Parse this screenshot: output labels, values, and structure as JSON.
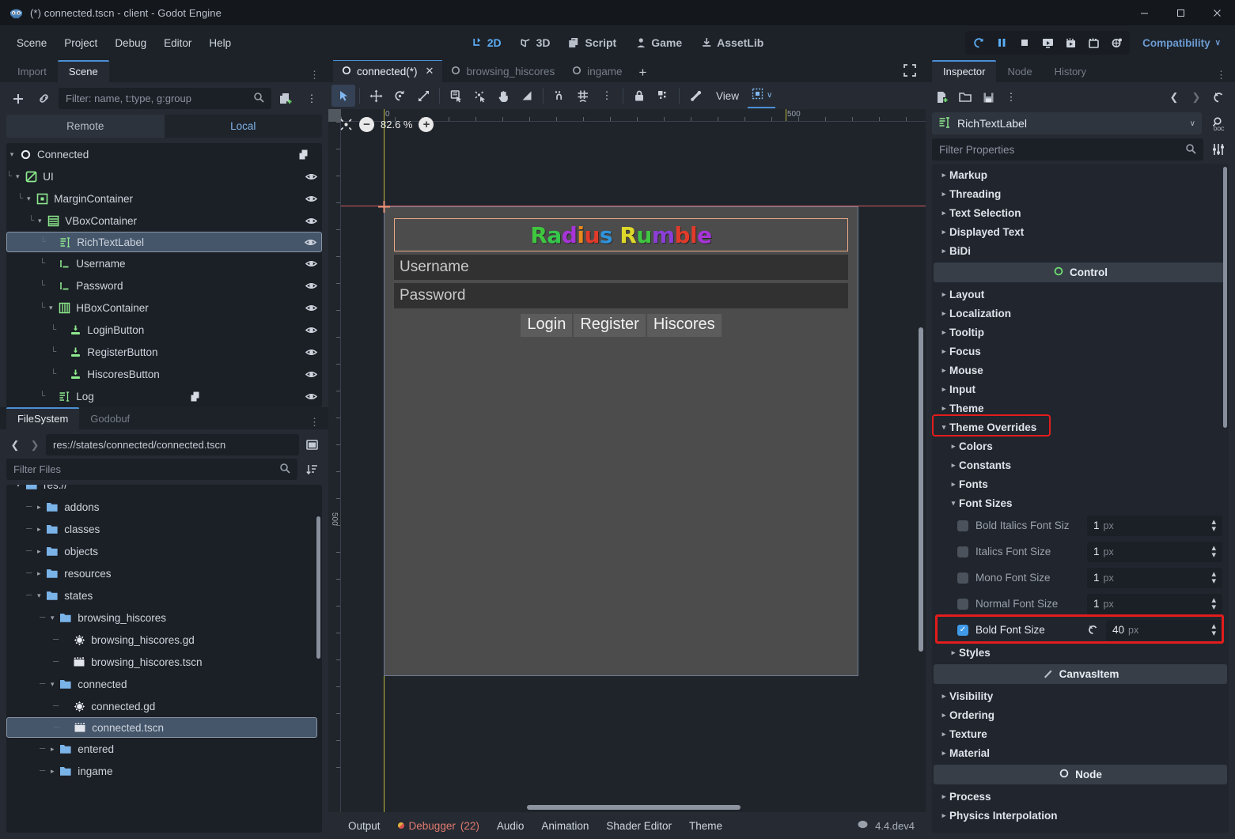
{
  "window": {
    "title": "(*) connected.tscn - client - Godot Engine",
    "minimize": "–",
    "maximize": "☐",
    "close": "✕"
  },
  "menubar": {
    "items": [
      "Scene",
      "Project",
      "Debug",
      "Editor",
      "Help"
    ]
  },
  "editor_modes": [
    {
      "label": "2D",
      "icon": "2d-mode-icon",
      "active": true
    },
    {
      "label": "3D",
      "icon": "3d-mode-icon",
      "active": false
    },
    {
      "label": "Script",
      "icon": "script-mode-icon",
      "active": false
    },
    {
      "label": "Game",
      "icon": "game-mode-icon",
      "active": false
    },
    {
      "label": "AssetLib",
      "icon": "assetlib-mode-icon",
      "active": false
    }
  ],
  "run_controls": {
    "buttons": [
      "run-project-icon",
      "pause-scene-icon",
      "stop-scene-icon",
      "run-current-scene-icon",
      "movie-writer-icon",
      "run-specific-scene-icon",
      "remote-debug-icon"
    ],
    "renderer": "Compatibility",
    "renderer_chevron": "∨"
  },
  "scene_dock": {
    "tabs": [
      {
        "label": "Import",
        "active": false
      },
      {
        "label": "Scene",
        "active": true
      }
    ],
    "toolbar": {
      "add_node": "+",
      "instantiate_icon": "link-icon",
      "create_script_icon": "new-script-icon",
      "more_icon": "vertical-dots-icon"
    },
    "filter_placeholder": "Filter: name, t:type, g:group",
    "remote_local": [
      {
        "label": "Remote",
        "active": false
      },
      {
        "label": "Local",
        "active": true
      }
    ],
    "nodes": [
      {
        "label": "Connected",
        "indent": 0,
        "icon": "node2d-icon",
        "expander": "v",
        "script": true,
        "eye": false,
        "selected": false
      },
      {
        "label": "UI",
        "indent": 1,
        "icon": "canvaslayer-icon",
        "expander": "v",
        "script": false,
        "eye": true,
        "selected": false
      },
      {
        "label": "MarginContainer",
        "indent": 2,
        "icon": "margincontainer-icon",
        "expander": "v",
        "script": false,
        "eye": true,
        "selected": false
      },
      {
        "label": "VBoxContainer",
        "indent": 3,
        "icon": "vboxcontainer-icon",
        "expander": "v",
        "script": false,
        "eye": true,
        "selected": false
      },
      {
        "label": "RichTextLabel",
        "indent": 4,
        "icon": "richtextlabel-icon",
        "expander": "",
        "script": false,
        "eye": true,
        "selected": true
      },
      {
        "label": "Username",
        "indent": 4,
        "icon": "lineedit-icon",
        "expander": "",
        "script": false,
        "eye": true,
        "selected": false
      },
      {
        "label": "Password",
        "indent": 4,
        "icon": "lineedit-icon",
        "expander": "",
        "script": false,
        "eye": true,
        "selected": false
      },
      {
        "label": "HBoxContainer",
        "indent": 4,
        "icon": "hboxcontainer-icon",
        "expander": "v",
        "script": false,
        "eye": true,
        "selected": false
      },
      {
        "label": "LoginButton",
        "indent": 5,
        "icon": "button-icon",
        "expander": "",
        "script": false,
        "eye": true,
        "selected": false
      },
      {
        "label": "RegisterButton",
        "indent": 5,
        "icon": "button-icon",
        "expander": "",
        "script": false,
        "eye": true,
        "selected": false
      },
      {
        "label": "HiscoresButton",
        "indent": 5,
        "icon": "button-icon",
        "expander": "",
        "script": false,
        "eye": true,
        "selected": false
      },
      {
        "label": "Log",
        "indent": 4,
        "icon": "richtextlabel-icon",
        "expander": "",
        "script": true,
        "eye": true,
        "selected": false
      }
    ]
  },
  "filesystem_dock": {
    "tabs": [
      {
        "label": "FileSystem",
        "active": true
      },
      {
        "label": "Godobuf",
        "active": false
      }
    ],
    "back_icon": "chevron-left-icon",
    "forward_icon": "chevron-right-icon",
    "path": "res://states/connected/connected.tscn",
    "toggle_split_icon": "toggle-split-mode-icon",
    "filter_placeholder": "Filter Files",
    "sort_icon": "sort-icon",
    "entries": [
      {
        "label": "res://",
        "indent": 0,
        "type": "folder",
        "expander": "v",
        "selected": false,
        "clipped": true
      },
      {
        "label": "addons",
        "indent": 1,
        "type": "folder",
        "expander": ">",
        "selected": false
      },
      {
        "label": "classes",
        "indent": 1,
        "type": "folder",
        "expander": ">",
        "selected": false
      },
      {
        "label": "objects",
        "indent": 1,
        "type": "folder",
        "expander": ">",
        "selected": false
      },
      {
        "label": "resources",
        "indent": 1,
        "type": "folder",
        "expander": ">",
        "selected": false
      },
      {
        "label": "states",
        "indent": 1,
        "type": "folder",
        "expander": "v",
        "selected": false
      },
      {
        "label": "browsing_hiscores",
        "indent": 2,
        "type": "folder",
        "expander": "v",
        "selected": false
      },
      {
        "label": "browsing_hiscores.gd",
        "indent": 3,
        "type": "script",
        "expander": "",
        "selected": false
      },
      {
        "label": "browsing_hiscores.tscn",
        "indent": 3,
        "type": "scene",
        "expander": "",
        "selected": false
      },
      {
        "label": "connected",
        "indent": 2,
        "type": "folder",
        "expander": "v",
        "selected": false
      },
      {
        "label": "connected.gd",
        "indent": 3,
        "type": "script",
        "expander": "",
        "selected": false
      },
      {
        "label": "connected.tscn",
        "indent": 3,
        "type": "scene",
        "expander": "",
        "selected": true
      },
      {
        "label": "entered",
        "indent": 2,
        "type": "folder",
        "expander": ">",
        "selected": false
      },
      {
        "label": "ingame",
        "indent": 2,
        "type": "folder",
        "expander": ">",
        "selected": false
      }
    ]
  },
  "scene_tabs": {
    "tabs": [
      {
        "label": "connected(*)",
        "active": true,
        "closable": true
      },
      {
        "label": "browsing_hiscores",
        "active": false,
        "closable": false
      },
      {
        "label": "ingame",
        "active": false,
        "closable": false
      }
    ],
    "add_tab": "+",
    "fullscreen_icon": "distraction-free-icon"
  },
  "canvas_toolbar": {
    "tools": [
      {
        "icon": "select-mode-icon",
        "active": true
      },
      {
        "icon": "move-mode-icon",
        "active": false
      },
      {
        "icon": "rotate-mode-icon",
        "active": false
      },
      {
        "icon": "scale-mode-icon",
        "active": false
      },
      {
        "icon": "list-select-icon",
        "active": false
      },
      {
        "icon": "pivot-mode-icon",
        "active": false
      },
      {
        "icon": "pan-mode-icon",
        "active": false
      },
      {
        "icon": "ruler-mode-icon",
        "active": false
      },
      {
        "icon": "smart-snap-icon",
        "active": false
      },
      {
        "icon": "grid-snap-icon",
        "active": false
      },
      {
        "icon": "snap-options-dots-icon",
        "active": false
      },
      {
        "icon": "lock-icon",
        "active": false
      },
      {
        "icon": "group-icon",
        "active": false
      },
      {
        "icon": "skeleton-bone-icon",
        "active": false
      }
    ],
    "view_label": "View",
    "snap_icon": "snap-grid-icon",
    "snap_chevron": "∨"
  },
  "viewport": {
    "zoom_reset_icon": "center-view-icon",
    "zoom_out": "−",
    "zoom_level": "82.6 %",
    "zoom_in": "+",
    "ruler_labels_h": [
      "0",
      "500"
    ],
    "ruler_labels_v": [
      "500"
    ]
  },
  "game_preview": {
    "title_letters": [
      {
        "ch": "R",
        "color": "#3fc63f"
      },
      {
        "ch": "a",
        "color": "#35c74a"
      },
      {
        "ch": "d",
        "color": "#a734d7"
      },
      {
        "ch": "i",
        "color": "#e8881d"
      },
      {
        "ch": "u",
        "color": "#e23a2a"
      },
      {
        "ch": "s",
        "color": "#2f93dd"
      },
      {
        "ch": " ",
        "color": "#ffffff"
      },
      {
        "ch": "R",
        "color": "#ddd82a"
      },
      {
        "ch": "u",
        "color": "#3fc63f"
      },
      {
        "ch": "m",
        "color": "#8b3ed8"
      },
      {
        "ch": "b",
        "color": "#e23a2a"
      },
      {
        "ch": "l",
        "color": "#e23a2a"
      },
      {
        "ch": "e",
        "color": "#a734d7"
      }
    ],
    "title_plain": "Radius Rumble",
    "username_placeholder": "Username",
    "password_placeholder": "Password",
    "buttons": [
      "Login",
      "Register",
      "Hiscores"
    ]
  },
  "bottom_panel": {
    "items": [
      {
        "label": "Output",
        "badge": "",
        "alert": false
      },
      {
        "label": "Debugger",
        "badge": "(22)",
        "alert": true
      },
      {
        "label": "Audio",
        "badge": "",
        "alert": false
      },
      {
        "label": "Animation",
        "badge": "",
        "alert": false
      },
      {
        "label": "Shader Editor",
        "badge": "",
        "alert": false
      },
      {
        "label": "Theme",
        "badge": "",
        "alert": false
      }
    ],
    "version": "4.4.dev4",
    "version_icon": "godot-small-icon"
  },
  "inspector": {
    "tabs": [
      {
        "label": "Inspector",
        "active": true
      },
      {
        "label": "Node",
        "active": false
      },
      {
        "label": "History",
        "active": false
      }
    ],
    "dock_menu_icon": "vertical-dots-icon",
    "toolbar": [
      "new-resource-icon",
      "load-resource-icon",
      "save-resource-icon",
      "resource-extra-menu-icon"
    ],
    "nav": [
      "history-prev-icon",
      "history-next-icon",
      "history-menu-icon"
    ],
    "object_name": "RichTextLabel",
    "object_icon": "richtextlabel-icon",
    "object_chevron": "∨",
    "open_docs_icon": "open-documentation-icon",
    "filter_placeholder": "Filter Properties",
    "filter_search_icon": "search-icon",
    "object_tools_icon": "property-tools-icon",
    "properties": [
      {
        "label": "Markup",
        "kind": "group",
        "level": 1,
        "expanded": false
      },
      {
        "label": "Threading",
        "kind": "group",
        "level": 1,
        "expanded": false
      },
      {
        "label": "Text Selection",
        "kind": "group",
        "level": 1,
        "expanded": false
      },
      {
        "label": "Displayed Text",
        "kind": "group",
        "level": 1,
        "expanded": false
      },
      {
        "label": "BiDi",
        "kind": "group",
        "level": 1,
        "expanded": false
      },
      {
        "label": "Control",
        "kind": "category",
        "icon": "control-icon"
      },
      {
        "label": "Layout",
        "kind": "group",
        "level": 1,
        "expanded": false
      },
      {
        "label": "Localization",
        "kind": "group",
        "level": 1,
        "expanded": false
      },
      {
        "label": "Tooltip",
        "kind": "group",
        "level": 1,
        "expanded": false
      },
      {
        "label": "Focus",
        "kind": "group",
        "level": 1,
        "expanded": false
      },
      {
        "label": "Mouse",
        "kind": "group",
        "level": 1,
        "expanded": false
      },
      {
        "label": "Input",
        "kind": "group",
        "level": 1,
        "expanded": false
      },
      {
        "label": "Theme",
        "kind": "group",
        "level": 1,
        "expanded": false
      },
      {
        "label": "Theme Overrides",
        "kind": "group",
        "level": 1,
        "expanded": true,
        "highlighted": true
      },
      {
        "label": "Colors",
        "kind": "group",
        "level": 2,
        "expanded": false
      },
      {
        "label": "Constants",
        "kind": "group",
        "level": 2,
        "expanded": false
      },
      {
        "label": "Fonts",
        "kind": "group",
        "level": 2,
        "expanded": false
      },
      {
        "label": "Font Sizes",
        "kind": "group",
        "level": 2,
        "expanded": true
      },
      {
        "label": "Styles",
        "kind": "group",
        "level": 2,
        "expanded": false
      },
      {
        "label": "CanvasItem",
        "kind": "category",
        "icon": "canvasitem-icon"
      },
      {
        "label": "Visibility",
        "kind": "group",
        "level": 1,
        "expanded": false
      },
      {
        "label": "Ordering",
        "kind": "group",
        "level": 1,
        "expanded": false
      },
      {
        "label": "Texture",
        "kind": "group",
        "level": 1,
        "expanded": false
      },
      {
        "label": "Material",
        "kind": "group",
        "level": 1,
        "expanded": false
      },
      {
        "label": "Node",
        "kind": "category",
        "icon": "node-icon"
      },
      {
        "label": "Process",
        "kind": "group",
        "level": 1,
        "expanded": false
      },
      {
        "label": "Physics Interpolation",
        "kind": "group",
        "level": 1,
        "expanded": false
      }
    ],
    "font_sizes": [
      {
        "label": "Bold Italics Font Siz",
        "checked": false,
        "value": "1",
        "unit": "px",
        "revert": false,
        "highlighted": false
      },
      {
        "label": "Italics Font Size",
        "checked": false,
        "value": "1",
        "unit": "px",
        "revert": false,
        "highlighted": false
      },
      {
        "label": "Mono Font Size",
        "checked": false,
        "value": "1",
        "unit": "px",
        "revert": false,
        "highlighted": false
      },
      {
        "label": "Normal Font Size",
        "checked": false,
        "value": "1",
        "unit": "px",
        "revert": false,
        "highlighted": false
      },
      {
        "label": "Bold Font Size",
        "checked": true,
        "value": "40",
        "unit": "px",
        "revert": true,
        "highlighted": true
      }
    ],
    "checkmark": "✓",
    "spinner_glyph": "⬍"
  },
  "colors": {
    "accent": "#4b8fd6",
    "highlight_red": "#e31c1c",
    "selection": "#45566b",
    "panel": "#262b33",
    "dark_panel": "#1b1f26",
    "window_bg": "#1d2229",
    "folder_blue": "#7ab3e8",
    "node_green": "#8eea8e"
  }
}
